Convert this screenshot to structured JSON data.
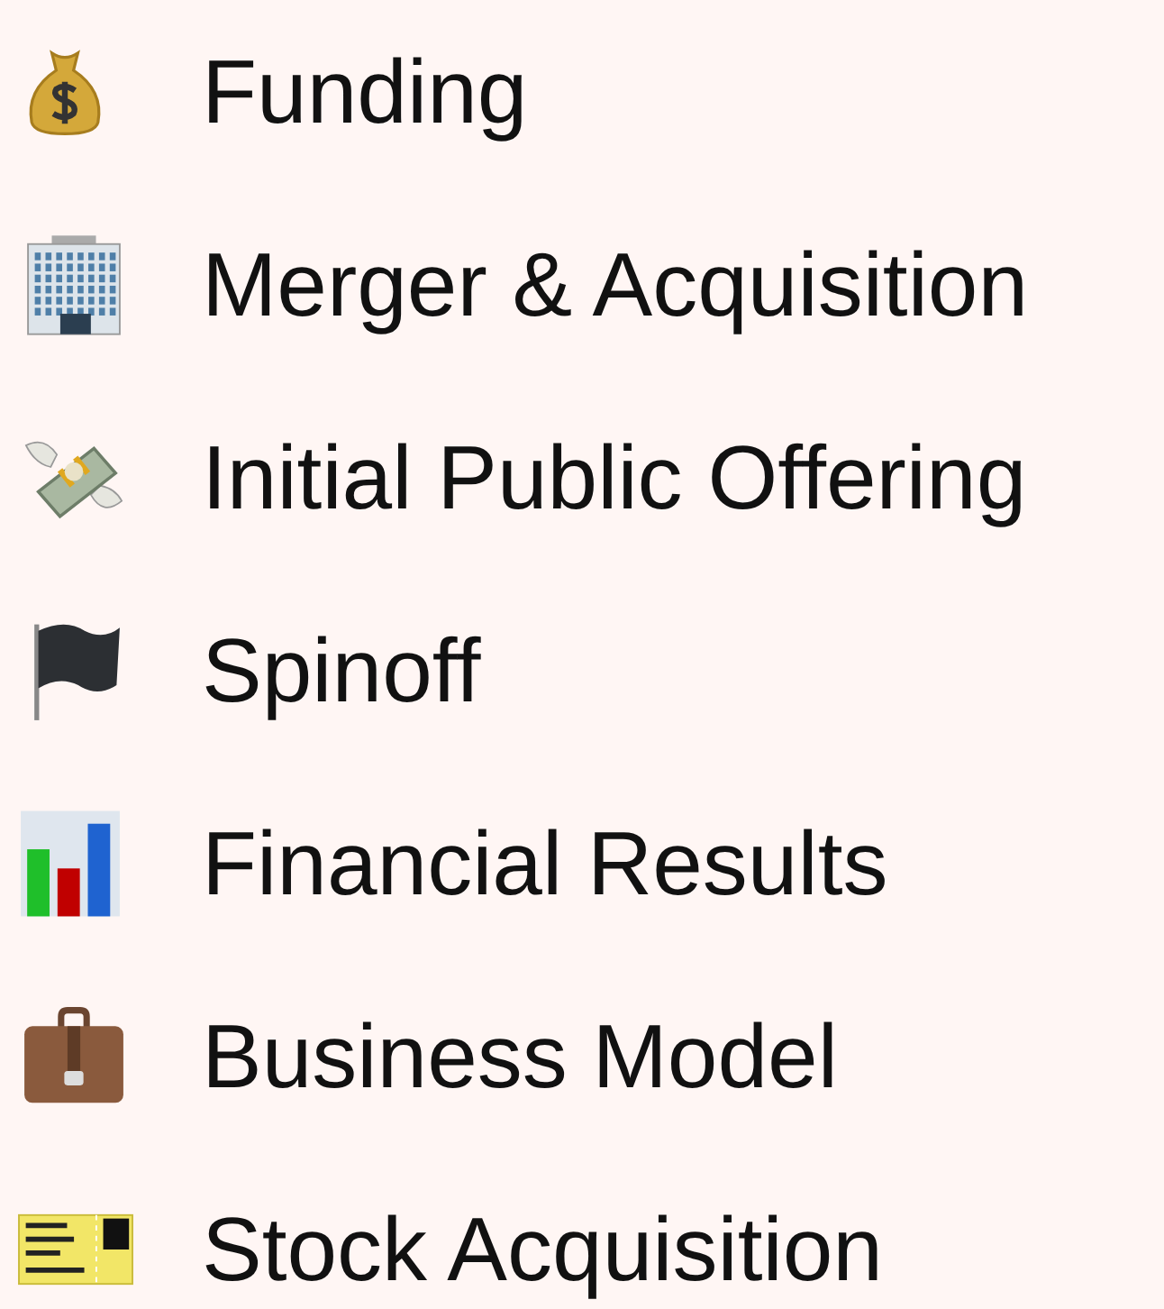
{
  "items": [
    {
      "kind": "moneybag",
      "label": "Funding"
    },
    {
      "kind": "building",
      "label": "Merger & Acquisition"
    },
    {
      "kind": "banknotes",
      "label": "Initial Public Offering"
    },
    {
      "kind": "flag",
      "label": "Spinoff"
    },
    {
      "kind": "chart",
      "label": "Financial Results"
    },
    {
      "kind": "briefcase",
      "label": "Business Model"
    },
    {
      "kind": "ticket",
      "label": "Stock Acquisition"
    }
  ]
}
